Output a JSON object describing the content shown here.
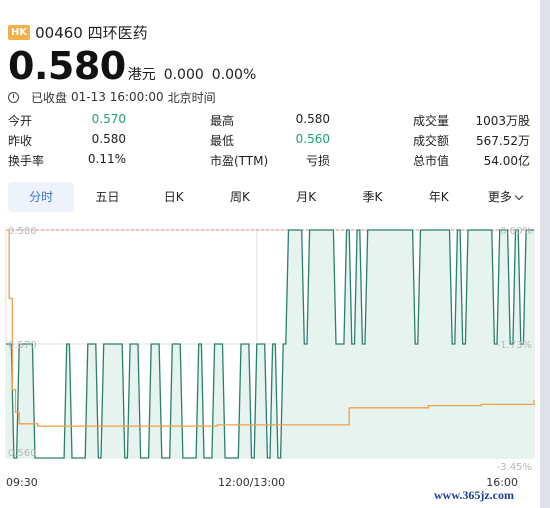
{
  "header": {
    "market_badge": "HK",
    "stock_code_name": "00460 四环医药"
  },
  "quote": {
    "price": "0.580",
    "currency": "港元",
    "change": "0.000",
    "change_pct": "0.00%",
    "status": "已收盘",
    "time": "01-13 16:00:00",
    "timezone": "北京时间"
  },
  "stats": [
    [
      {
        "label": "今开",
        "value": "0.570",
        "green": true
      },
      {
        "label": "最高",
        "value": "0.580"
      },
      {
        "label": "成交量",
        "value": "1003万股"
      }
    ],
    [
      {
        "label": "昨收",
        "value": "0.580"
      },
      {
        "label": "最低",
        "value": "0.560",
        "green": true
      },
      {
        "label": "成交额",
        "value": "567.52万"
      }
    ],
    [
      {
        "label": "换手率",
        "value": "0.11%"
      },
      {
        "label": "市盈(TTM)",
        "value": "亏损"
      },
      {
        "label": "总市值",
        "value": "54.00亿"
      }
    ]
  ],
  "tabs": [
    "分时",
    "五日",
    "日K",
    "周K",
    "月K",
    "季K",
    "年K",
    "更多"
  ],
  "active_tab": "分时",
  "colors": {
    "price_line": "#2a7f6f",
    "avg_line": "#f0a04a",
    "fill": "#e6f3ef",
    "grid": "#e2e2e2",
    "prev_close": "#f08080",
    "down": "#1aa37a"
  },
  "chart_data": {
    "type": "line",
    "y_axis_left": [
      "0.580",
      "0.570",
      "0.560"
    ],
    "y_axis_right": [
      "0.00%",
      "-1.73%",
      "-3.45%"
    ],
    "x_labels": [
      "09:30",
      "12:00/13:00",
      "16:00"
    ],
    "ylim": [
      0.56,
      0.58
    ],
    "series": [
      {
        "role": "price",
        "x": [
          0,
          1,
          1.5,
          2,
          2.5,
          5,
          5.5,
          11,
          11.5,
          12,
          12.5,
          15,
          15.5,
          17,
          17.5,
          18,
          18.5,
          22,
          22.5,
          23,
          23.5,
          25,
          25.5,
          27,
          27.5,
          29,
          29.5,
          31,
          31.5,
          33,
          33.5,
          36,
          36.5,
          37,
          37.5,
          39,
          39.5,
          41,
          41.5,
          44,
          44.5,
          46,
          46.5,
          47,
          47.5,
          49,
          49.5,
          50,
          50.5,
          51,
          51.5,
          52,
          52.5,
          53,
          53.5,
          56,
          56.5,
          57,
          57.5,
          62,
          62.5,
          64,
          64.5,
          65,
          65.5,
          66,
          66.5,
          67,
          67.5,
          68,
          68.5,
          77,
          77.5,
          78,
          78.5,
          84,
          84.5,
          85,
          85.5,
          86,
          86.5,
          87,
          87.5,
          92,
          92.5,
          93,
          93.5,
          95,
          95.5,
          96,
          96.5,
          97,
          97.5,
          98,
          98.5,
          100
        ],
        "y": [
          0.57,
          0.57,
          0.56,
          0.56,
          0.57,
          0.57,
          0.56,
          0.56,
          0.57,
          0.57,
          0.56,
          0.56,
          0.57,
          0.57,
          0.56,
          0.56,
          0.57,
          0.57,
          0.56,
          0.56,
          0.57,
          0.57,
          0.56,
          0.56,
          0.57,
          0.57,
          0.56,
          0.56,
          0.57,
          0.57,
          0.56,
          0.56,
          0.57,
          0.57,
          0.56,
          0.56,
          0.57,
          0.57,
          0.56,
          0.56,
          0.57,
          0.57,
          0.56,
          0.56,
          0.57,
          0.57,
          0.56,
          0.56,
          0.57,
          0.57,
          0.56,
          0.56,
          0.57,
          0.57,
          0.58,
          0.58,
          0.57,
          0.57,
          0.58,
          0.58,
          0.57,
          0.57,
          0.58,
          0.58,
          0.57,
          0.57,
          0.58,
          0.58,
          0.57,
          0.57,
          0.58,
          0.58,
          0.57,
          0.57,
          0.58,
          0.58,
          0.57,
          0.57,
          0.58,
          0.58,
          0.57,
          0.57,
          0.58,
          0.58,
          0.57,
          0.57,
          0.58,
          0.58,
          0.57,
          0.57,
          0.58,
          0.58,
          0.57,
          0.57,
          0.58,
          0.58
        ]
      },
      {
        "role": "average",
        "x": [
          0,
          0.6,
          1.2,
          1.8,
          2.5,
          3,
          6,
          10,
          20,
          30,
          40,
          45,
          50,
          52,
          60,
          64,
          65,
          70,
          80,
          90,
          100
        ],
        "y": [
          0.58,
          0.574,
          0.566,
          0.564,
          0.563,
          0.563,
          0.5628,
          0.5628,
          0.5628,
          0.5628,
          0.5629,
          0.5629,
          0.5629,
          0.5629,
          0.5629,
          0.5629,
          0.5644,
          0.5644,
          0.5646,
          0.5647,
          0.5651
        ]
      }
    ]
  },
  "watermark": "www.365jz.com"
}
